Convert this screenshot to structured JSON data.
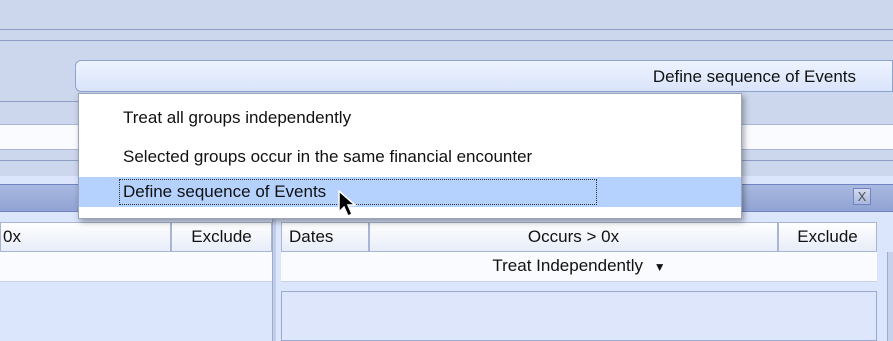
{
  "combo": {
    "label": "Define sequence of Events"
  },
  "menu": {
    "items": [
      {
        "label": "Treat all groups independently"
      },
      {
        "label": "Selected groups occur in the same financial encounter"
      },
      {
        "label": "Define sequence of Events",
        "selected": true
      }
    ]
  },
  "left_panel": {
    "headers": {
      "occurs": "0x",
      "exclude": "Exclude"
    }
  },
  "right_panel": {
    "close_glyph": "X",
    "headers": {
      "dates": "Dates",
      "occurs": "Occurs > 0x",
      "exclude": "Exclude"
    },
    "mode_label": "Treat Independently",
    "mode_arrow": "▼"
  },
  "colors": {
    "background": "#ccd6ec",
    "highlight": "#b4d2fd",
    "title_bar": "#91a3d3"
  }
}
